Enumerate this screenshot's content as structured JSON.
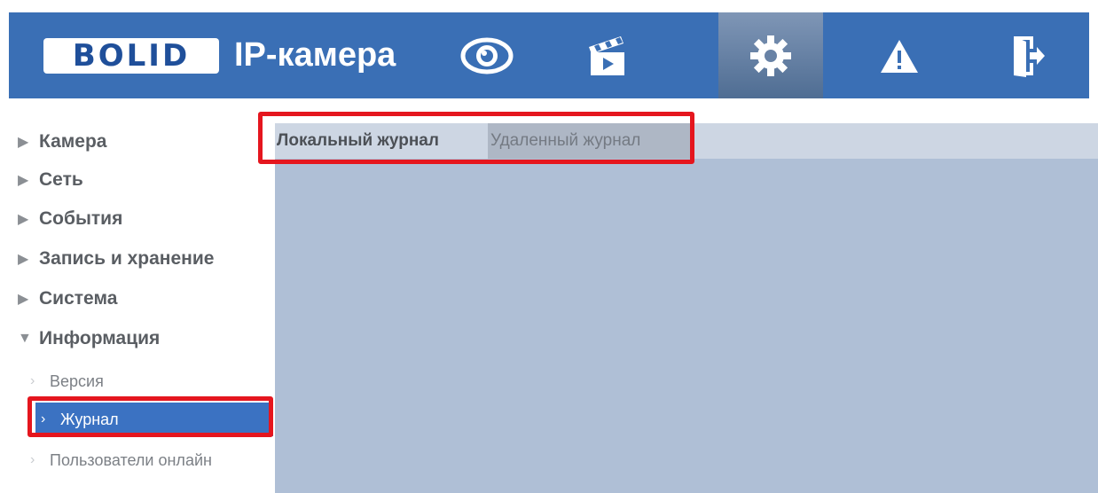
{
  "header": {
    "logo": "BOLID",
    "title": "IP-камера",
    "nav_icons": [
      "eye-icon",
      "clapperboard-icon",
      "gear-icon",
      "warning-icon",
      "exit-icon"
    ],
    "active_icon": "gear-icon"
  },
  "sidebar": {
    "items": [
      {
        "label": "Камера",
        "expanded": false
      },
      {
        "label": "Сеть",
        "expanded": false
      },
      {
        "label": "События",
        "expanded": false
      },
      {
        "label": "Запись и хранение",
        "expanded": false
      },
      {
        "label": "Система",
        "expanded": false
      },
      {
        "label": "Информация",
        "expanded": true
      }
    ],
    "subitems": [
      {
        "label": "Версия"
      },
      {
        "label": "Журнал",
        "selected": true
      },
      {
        "label": "Пользователи онлайн"
      }
    ]
  },
  "tabs": [
    {
      "label": "Локальный журнал",
      "active": true
    },
    {
      "label": "Удаленный журнал",
      "active": false
    }
  ],
  "colors": {
    "header_bg": "#3a6fb5",
    "content_bg": "#afbfd6",
    "selected_bg": "#3b72c2",
    "highlight_border": "#e5161e"
  }
}
